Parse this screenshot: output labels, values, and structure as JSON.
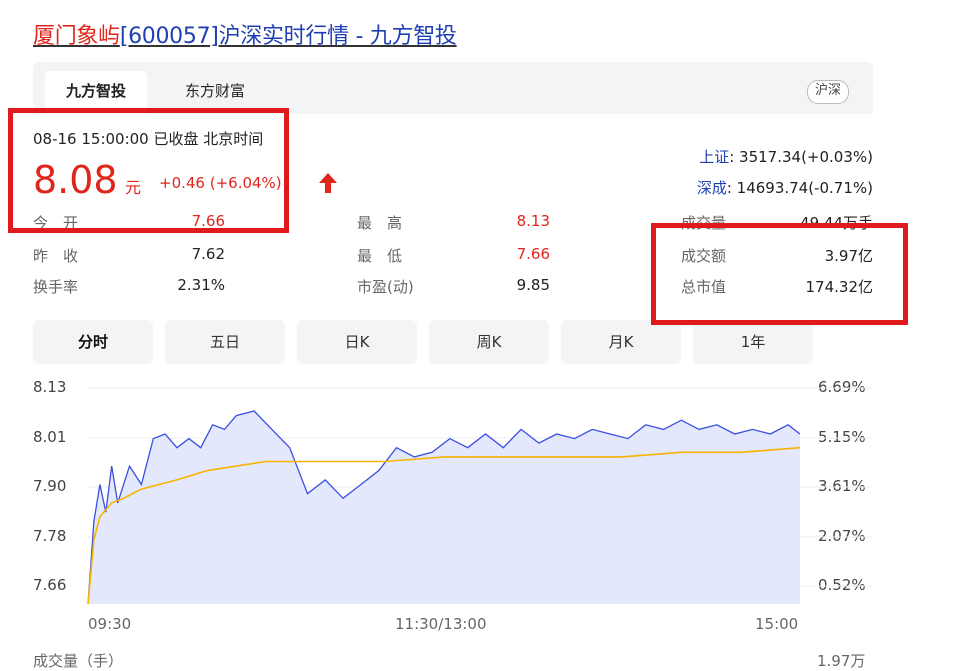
{
  "page_title": {
    "name": "厦门象屿",
    "code": "[600057]",
    "rest": "沪深实时行情 - 九方智投"
  },
  "source_tabs": [
    "九方智投",
    "东方财富"
  ],
  "market_pill": "沪深",
  "quote": {
    "datetime": "08-16 15:00:00  已收盘  北京时间",
    "price": "8.08",
    "unit": "元",
    "change": "+0.46 (+6.04%)"
  },
  "indices": [
    {
      "label": "上证",
      "value": ": 3517.34(+0.03%)"
    },
    {
      "label": "深成",
      "value": ": 14693.74(-0.71%)"
    }
  ],
  "stats": [
    {
      "label": "今　开",
      "value": "7.66",
      "color": "#e0261c"
    },
    {
      "label": "昨　收",
      "value": "7.62"
    },
    {
      "label": "换手率",
      "value": "2.31%"
    },
    {
      "label": "最　高",
      "value": "8.13",
      "color": "#e0261c"
    },
    {
      "label": "最　低",
      "value": "7.66",
      "color": "#e0261c"
    },
    {
      "label": "市盈(动)",
      "value": "9.85"
    },
    {
      "label": "成交量",
      "value": "49.44万手"
    },
    {
      "label": "成交额",
      "value": "3.97亿"
    },
    {
      "label": "总市值",
      "value": "174.32亿"
    }
  ],
  "period_tabs": [
    "分时",
    "五日",
    "日K",
    "周K",
    "月K",
    "1年"
  ],
  "volume_label": "成交量（手）",
  "volume_max": "1.97万",
  "colors": {
    "up": "#e0261c",
    "price_line": "#3b4fe0",
    "avg_line": "#f5b400",
    "fill": "#dfe4fb",
    "highlight_box": "#e0191c"
  },
  "chart_data": {
    "type": "line",
    "xlabel": "",
    "ylabel": "",
    "x_ticks": [
      "09:30",
      "11:30/13:00",
      "15:00"
    ],
    "y_ticks_left": [
      "8.13",
      "8.01",
      "7.90",
      "7.78",
      "7.66"
    ],
    "y_ticks_right": [
      "6.69%",
      "5.15%",
      "3.61%",
      "2.07%",
      "0.52%"
    ],
    "ylim": [
      7.66,
      8.13
    ],
    "grid": true,
    "series": [
      {
        "role": "price",
        "x": [
          0,
          2,
          4,
          6,
          8,
          10,
          14,
          18,
          22,
          26,
          30,
          34,
          38,
          42,
          46,
          50,
          56,
          62,
          68,
          74,
          80,
          86,
          92,
          98,
          104,
          110,
          116,
          122,
          128,
          134,
          140,
          146,
          152,
          158,
          164,
          170,
          176,
          182,
          188,
          194,
          200,
          206,
          212,
          218,
          224,
          230,
          236,
          240
        ],
        "values": [
          7.66,
          7.84,
          7.92,
          7.86,
          7.96,
          7.88,
          7.96,
          7.92,
          8.02,
          8.03,
          8.0,
          8.02,
          8.0,
          8.05,
          8.04,
          8.07,
          8.08,
          8.04,
          8.0,
          7.9,
          7.93,
          7.89,
          7.92,
          7.95,
          8.0,
          7.98,
          7.99,
          8.02,
          8.0,
          8.03,
          8.0,
          8.04,
          8.01,
          8.03,
          8.02,
          8.04,
          8.03,
          8.02,
          8.05,
          8.04,
          8.06,
          8.04,
          8.05,
          8.03,
          8.04,
          8.03,
          8.05,
          8.03
        ]
      },
      {
        "role": "average",
        "x": [
          0,
          2,
          4,
          8,
          12,
          18,
          24,
          30,
          40,
          50,
          60,
          80,
          100,
          120,
          140,
          160,
          180,
          200,
          220,
          240
        ],
        "values": [
          7.66,
          7.8,
          7.85,
          7.88,
          7.89,
          7.91,
          7.92,
          7.93,
          7.95,
          7.96,
          7.97,
          7.97,
          7.97,
          7.98,
          7.98,
          7.98,
          7.98,
          7.99,
          7.99,
          8.0
        ]
      }
    ]
  }
}
